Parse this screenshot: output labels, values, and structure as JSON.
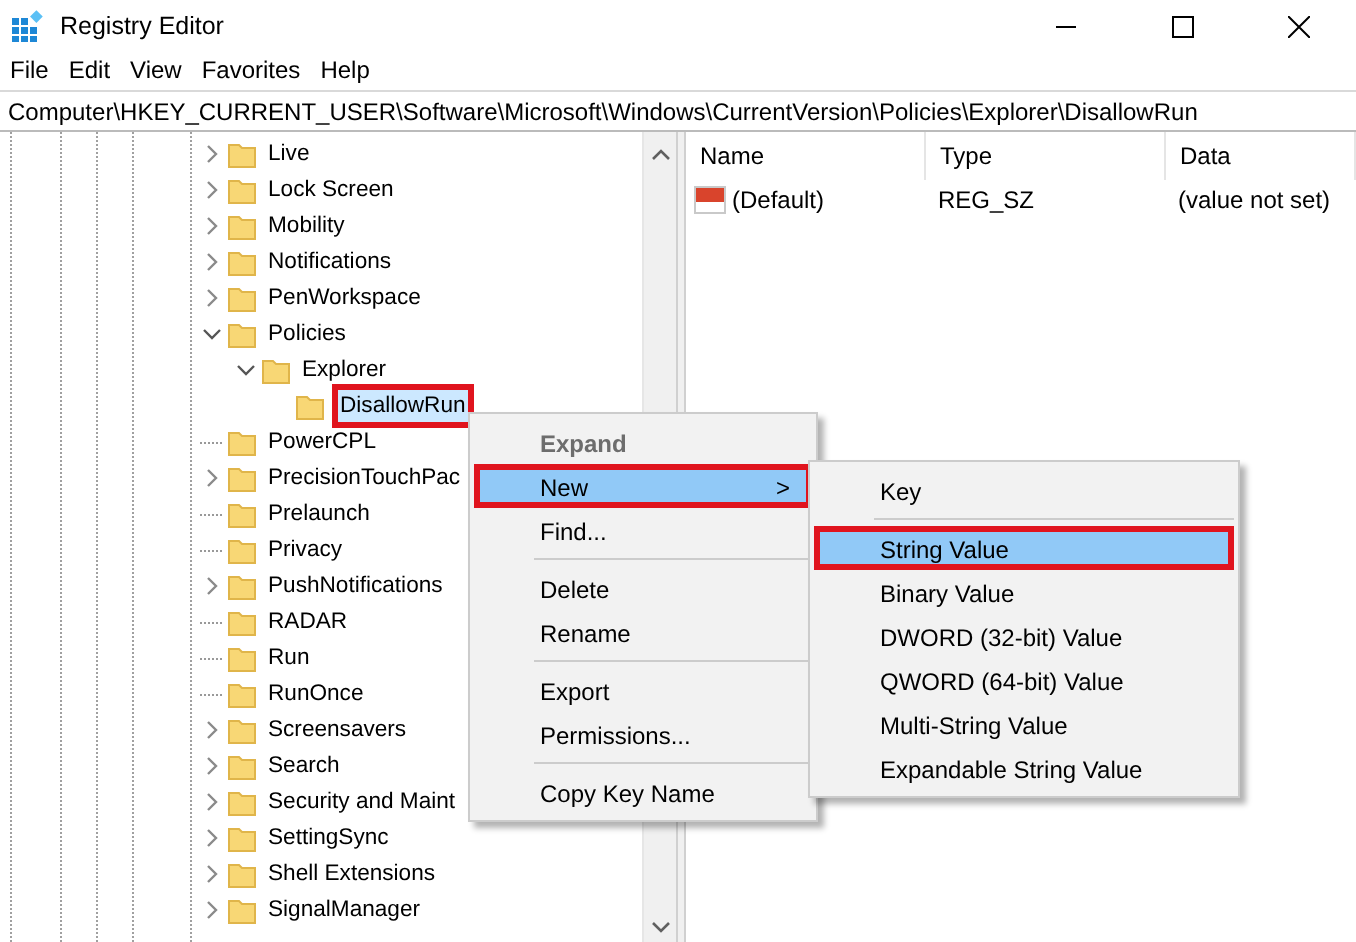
{
  "window": {
    "title": "Registry Editor"
  },
  "menu_bar": [
    "File",
    "Edit",
    "View",
    "Favorites",
    "Help"
  ],
  "address_bar": "Computer\\HKEY_CURRENT_USER\\Software\\Microsoft\\Windows\\CurrentVersion\\Policies\\Explorer\\DisallowRun",
  "tree": [
    {
      "kind": "branch",
      "label": "Live",
      "expanded": false,
      "selected": false
    },
    {
      "kind": "branch",
      "label": "Lock Screen",
      "expanded": false,
      "selected": false
    },
    {
      "kind": "branch",
      "label": "Mobility",
      "expanded": false,
      "selected": false
    },
    {
      "kind": "branch",
      "label": "Notifications",
      "expanded": false,
      "selected": false
    },
    {
      "kind": "branch",
      "label": "PenWorkspace",
      "expanded": false,
      "selected": false
    },
    {
      "kind": "branch",
      "label": "Policies",
      "expanded": true,
      "selected": false,
      "children": [
        {
          "kind": "branch",
          "label": "Explorer",
          "expanded": true,
          "selected": false,
          "children": [
            {
              "kind": "leaf",
              "label": "DisallowRun",
              "selected": true,
              "outlined": true
            }
          ]
        }
      ]
    },
    {
      "kind": "leaf",
      "label": "PowerCPL",
      "selected": false
    },
    {
      "kind": "branch",
      "label": "PrecisionTouchPac",
      "expanded": false,
      "selected": false
    },
    {
      "kind": "leaf",
      "label": "Prelaunch",
      "selected": false
    },
    {
      "kind": "leaf",
      "label": "Privacy",
      "selected": false
    },
    {
      "kind": "branch",
      "label": "PushNotifications",
      "expanded": false,
      "selected": false
    },
    {
      "kind": "leaf",
      "label": "RADAR",
      "selected": false
    },
    {
      "kind": "leaf",
      "label": "Run",
      "selected": false
    },
    {
      "kind": "leaf",
      "label": "RunOnce",
      "selected": false
    },
    {
      "kind": "branch",
      "label": "Screensavers",
      "expanded": false,
      "selected": false
    },
    {
      "kind": "branch",
      "label": "Search",
      "expanded": false,
      "selected": false
    },
    {
      "kind": "branch",
      "label": "Security and Maint",
      "expanded": false,
      "selected": false
    },
    {
      "kind": "branch",
      "label": "SettingSync",
      "expanded": false,
      "selected": false
    },
    {
      "kind": "branch",
      "label": "Shell Extensions",
      "expanded": false,
      "selected": false
    },
    {
      "kind": "branch",
      "label": "SignalManager",
      "expanded": false,
      "selected": false
    }
  ],
  "values": {
    "columns": [
      "Name",
      "Type",
      "Data"
    ],
    "rows": [
      {
        "name": "(Default)",
        "type": "REG_SZ",
        "data": "(value not set)"
      }
    ]
  },
  "context_menu": {
    "items": [
      {
        "kind": "item",
        "label": "Expand",
        "disabled": true,
        "selected": false
      },
      {
        "kind": "item",
        "label": "New",
        "disabled": false,
        "selected": true,
        "outlined": true,
        "arrow": ">"
      },
      {
        "kind": "item",
        "label": "Find...",
        "disabled": false,
        "selected": false
      },
      {
        "kind": "separator"
      },
      {
        "kind": "item",
        "label": "Delete",
        "disabled": false,
        "selected": false
      },
      {
        "kind": "item",
        "label": "Rename",
        "disabled": false,
        "selected": false
      },
      {
        "kind": "separator"
      },
      {
        "kind": "item",
        "label": "Export",
        "disabled": false,
        "selected": false
      },
      {
        "kind": "item",
        "label": "Permissions...",
        "disabled": false,
        "selected": false
      },
      {
        "kind": "separator"
      },
      {
        "kind": "item",
        "label": "Copy Key Name",
        "disabled": false,
        "selected": false
      }
    ]
  },
  "submenu": {
    "items": [
      {
        "kind": "item",
        "label": "Key",
        "selected": false
      },
      {
        "kind": "separator"
      },
      {
        "kind": "item",
        "label": "String Value",
        "selected": true,
        "outlined": true
      },
      {
        "kind": "item",
        "label": "Binary Value",
        "selected": false
      },
      {
        "kind": "item",
        "label": "DWORD (32-bit) Value",
        "selected": false
      },
      {
        "kind": "item",
        "label": "QWORD (64-bit) Value",
        "selected": false
      },
      {
        "kind": "item",
        "label": "Multi-String Value",
        "selected": false
      },
      {
        "kind": "item",
        "label": "Expandable String Value",
        "selected": false
      }
    ]
  }
}
